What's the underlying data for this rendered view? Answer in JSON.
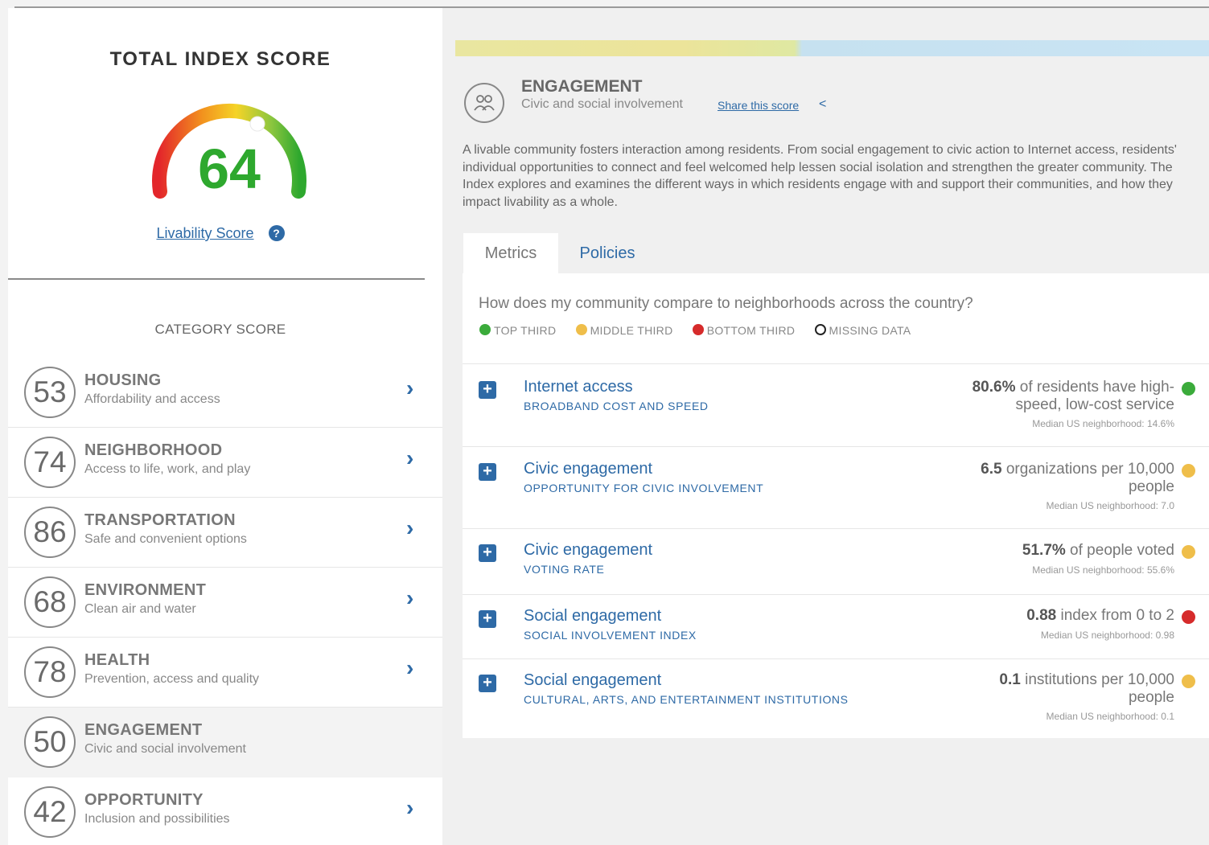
{
  "total": {
    "title": "TOTAL INDEX SCORE",
    "score": "64",
    "score_color": "#2ea82e",
    "livability_link": "Livability Score",
    "help_icon": "question-circle-icon"
  },
  "category_title": "CATEGORY SCORE",
  "categories": [
    {
      "score": "53",
      "name": "HOUSING",
      "subtitle": "Affordability and access"
    },
    {
      "score": "74",
      "name": "NEIGHBORHOOD",
      "subtitle": "Access to life, work, and play"
    },
    {
      "score": "86",
      "name": "TRANSPORTATION",
      "subtitle": "Safe and convenient options"
    },
    {
      "score": "68",
      "name": "ENVIRONMENT",
      "subtitle": "Clean air and water"
    },
    {
      "score": "78",
      "name": "HEALTH",
      "subtitle": "Prevention, access and quality"
    },
    {
      "score": "50",
      "name": "ENGAGEMENT",
      "subtitle": "Civic and social involvement",
      "active": true
    },
    {
      "score": "42",
      "name": "OPPORTUNITY",
      "subtitle": "Inclusion and possibilities"
    }
  ],
  "detail": {
    "icon": "people-group-icon",
    "title": "ENGAGEMENT",
    "subtitle": "Civic and social involvement",
    "share_label": "Share this score",
    "description": "A livable community fosters interaction among residents. From social engagement to civic action to Internet access, residents' individual opportunities to connect and feel welcomed help lessen social isolation and strengthen the greater community. The Index explores and examines the different ways in which residents engage with and support their communities, and how they impact livability as a whole.",
    "tabs": [
      "Metrics",
      "Policies"
    ],
    "question": "How does my community compare to neighborhoods across the country?",
    "legend": [
      {
        "label": "TOP THIRD",
        "color": "#3bab3b"
      },
      {
        "label": "MIDDLE THIRD",
        "color": "#efbe4a"
      },
      {
        "label": "BOTTOM THIRD",
        "color": "#d62b2b"
      },
      {
        "label": "MISSING DATA",
        "color": "#ffffff"
      }
    ],
    "metrics": [
      {
        "title": "Internet access",
        "subtitle": "BROADBAND COST AND SPEED",
        "stat_value": "80.6%",
        "stat_text_1": " of residents have high-",
        "stat_text_2": "speed, low-cost service",
        "median": "Median US neighborhood: 14.6%",
        "color": "#3bab3b"
      },
      {
        "title": "Civic engagement",
        "subtitle": "OPPORTUNITY FOR CIVIC INVOLVEMENT",
        "stat_value": "6.5",
        "stat_text_1": " organizations per 10,000",
        "stat_text_2": "people",
        "median": "Median US neighborhood: 7.0",
        "color": "#efbe4a"
      },
      {
        "title": "Civic engagement",
        "subtitle": "VOTING RATE",
        "stat_value": "51.7%",
        "stat_text_1": " of people voted",
        "stat_text_2": "",
        "median": "Median US neighborhood: 55.6%",
        "color": "#efbe4a"
      },
      {
        "title": "Social engagement",
        "subtitle": "SOCIAL INVOLVEMENT INDEX",
        "stat_value": "0.88",
        "stat_text_1": " index from 0 to 2",
        "stat_text_2": "",
        "median": "Median US neighborhood: 0.98",
        "color": "#d62b2b"
      },
      {
        "title": "Social engagement",
        "subtitle": "CULTURAL, ARTS, AND ENTERTAINMENT INSTITUTIONS",
        "stat_value": "0.1",
        "stat_text_1": " institutions per 10,000",
        "stat_text_2": "people",
        "median": "Median US neighborhood: 0.1",
        "color": "#efbe4a"
      }
    ]
  }
}
